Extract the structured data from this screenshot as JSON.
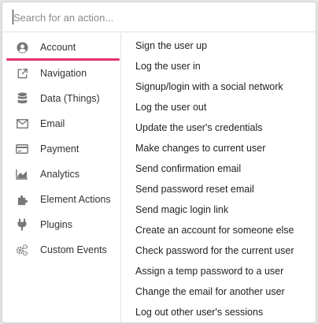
{
  "search": {
    "placeholder": "Search for an action...",
    "value": ""
  },
  "sidebar": {
    "active_index": 0,
    "accent_color": "#e8306f",
    "items": [
      {
        "label": "Account",
        "icon": "user-circle-icon"
      },
      {
        "label": "Navigation",
        "icon": "external-link-icon"
      },
      {
        "label": "Data (Things)",
        "icon": "database-icon"
      },
      {
        "label": "Email",
        "icon": "envelope-icon"
      },
      {
        "label": "Payment",
        "icon": "credit-card-icon"
      },
      {
        "label": "Analytics",
        "icon": "area-chart-icon"
      },
      {
        "label": "Element Actions",
        "icon": "puzzle-piece-icon"
      },
      {
        "label": "Plugins",
        "icon": "plug-icon"
      },
      {
        "label": "Custom Events",
        "icon": "cogs-icon"
      }
    ]
  },
  "actions": {
    "items": [
      {
        "label": "Sign the user up"
      },
      {
        "label": "Log the user in"
      },
      {
        "label": "Signup/login with a social network"
      },
      {
        "label": "Log the user out"
      },
      {
        "label": "Update the user's credentials"
      },
      {
        "label": "Make changes to current user"
      },
      {
        "label": "Send confirmation email"
      },
      {
        "label": "Send password reset email"
      },
      {
        "label": "Send magic login link"
      },
      {
        "label": "Create an account for someone else"
      },
      {
        "label": "Check password for the current user"
      },
      {
        "label": "Assign a temp password to a user"
      },
      {
        "label": "Change the email for another user"
      },
      {
        "label": "Log out other user's sessions"
      }
    ]
  }
}
